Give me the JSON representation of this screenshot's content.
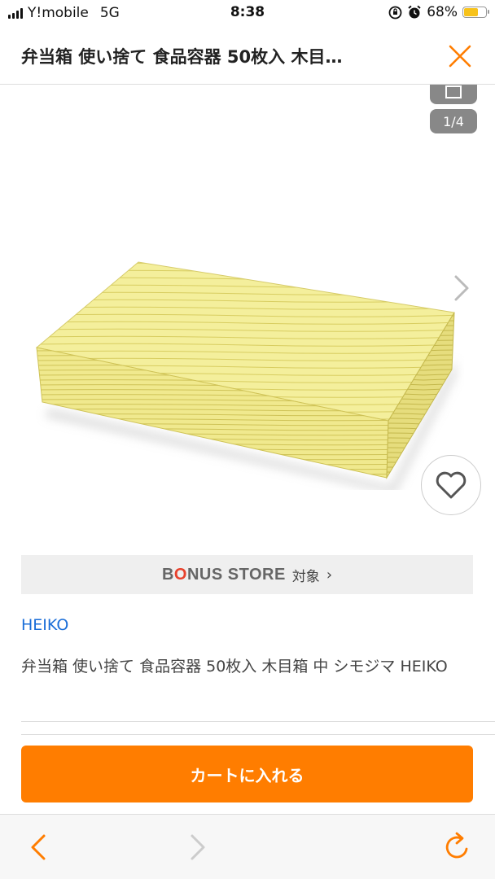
{
  "status_bar": {
    "carrier": "Y!mobile",
    "network": "5G",
    "time": "8:38",
    "battery": "68%",
    "battery_level": 0.68,
    "icons": [
      "signal-icon",
      "rotation-lock-icon",
      "alarm-icon",
      "battery-icon"
    ]
  },
  "header": {
    "title": "弁当箱 使い捨て 食品容器 50枚入 木目…",
    "close_icon": "close-icon",
    "accent_color": "#ff7d00"
  },
  "gallery": {
    "counter": "1/4",
    "next_icon": "chevron-right-icon",
    "favorite_icon": "heart-icon"
  },
  "bonus": {
    "logo": "BONUS STORE",
    "label": "対象",
    "chevron": "›"
  },
  "product": {
    "brand": "HEIKO",
    "name": "弁当箱 使い捨て 食品容器 50枚入 木目箱 中 シモジマ HEIKO",
    "brand_color": "#1a6ed8"
  },
  "cart": {
    "label": "カートに入れる",
    "color": "#ff7d00"
  },
  "toolbar": {
    "back_icon": "chevron-left-icon",
    "forward_icon": "chevron-right-icon",
    "reload_icon": "reload-icon"
  }
}
